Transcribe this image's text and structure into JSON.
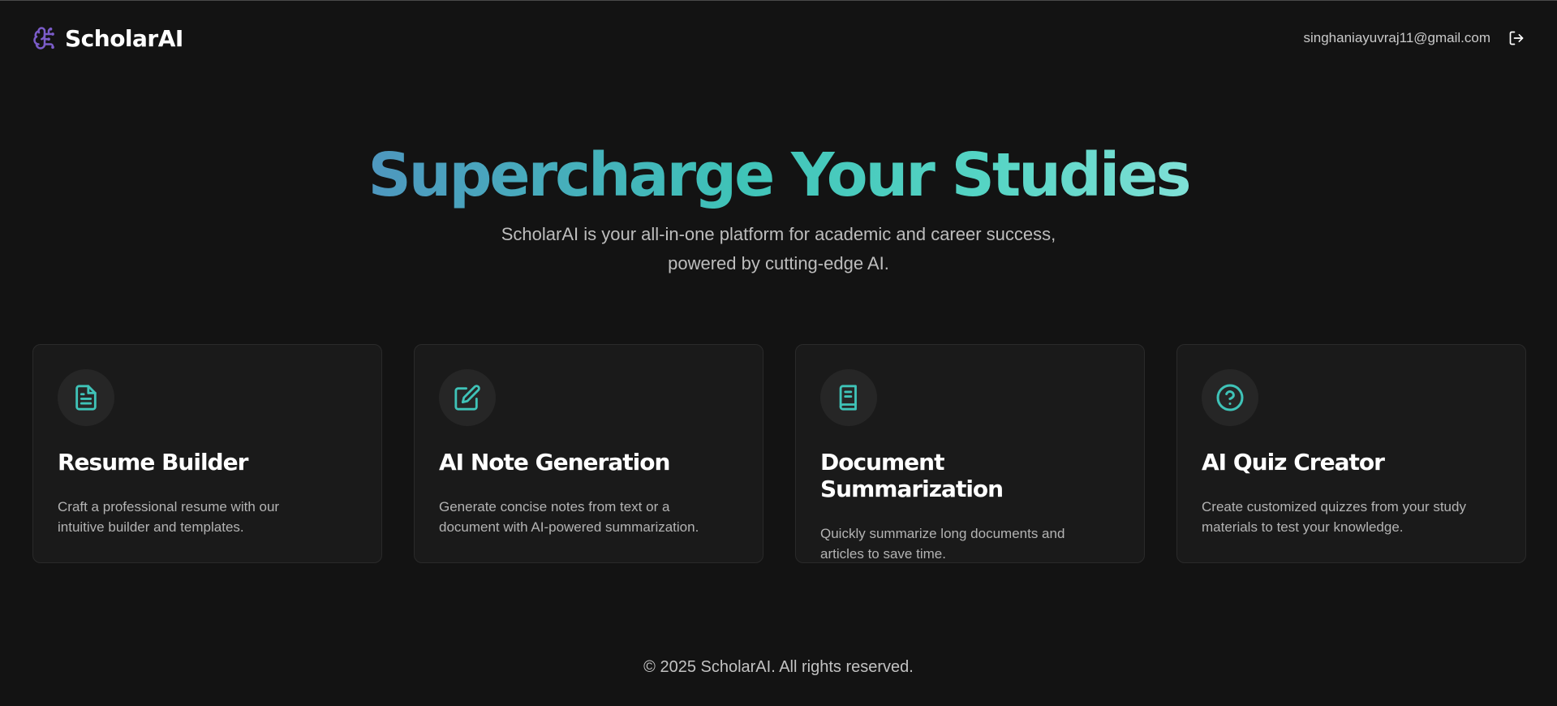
{
  "header": {
    "brand_icon": "brain-icon",
    "brand_name": "ScholarAI",
    "user_email": "singhaniayuvraj11@gmail.com",
    "logout_icon": "logout-icon"
  },
  "hero": {
    "title": "Supercharge Your Studies",
    "subtitle_line1": "ScholarAI is your all-in-one platform for academic and career success,",
    "subtitle_line2": "powered by cutting-edge AI."
  },
  "features": [
    {
      "icon": "file-text-icon",
      "title": "Resume Builder",
      "desc_line1": "Craft a professional resume with our",
      "desc_line2": "intuitive builder and templates."
    },
    {
      "icon": "edit-icon",
      "title": "AI Note Generation",
      "desc_line1": "Generate concise notes from text or a",
      "desc_line2": "document with AI-powered summarization."
    },
    {
      "icon": "book-icon",
      "title": "Document Summarization",
      "desc_line1": "Quickly summarize long documents and",
      "desc_line2": "articles to save time."
    },
    {
      "icon": "help-circle-icon",
      "title": "AI Quiz Creator",
      "desc_line1": "Create customized quizzes from your study",
      "desc_line2": "materials to test your knowledge."
    }
  ],
  "footer": {
    "copyright": "© 2025 ScholarAI. All rights reserved."
  },
  "colors": {
    "background": "#131313",
    "card_background": "#1a1a1a",
    "accent": "#3fc3b8",
    "brand_icon": "#7b5cc9"
  }
}
